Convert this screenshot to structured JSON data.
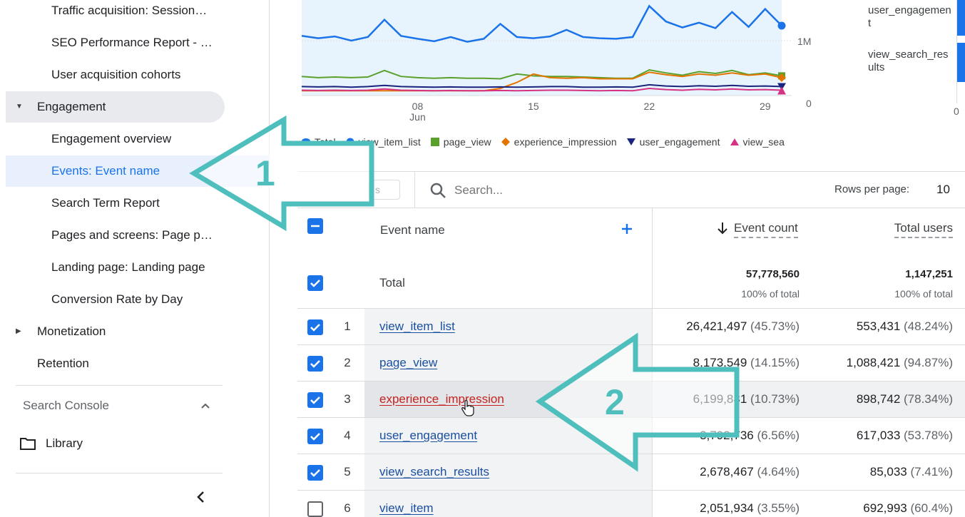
{
  "sidebar": {
    "items_sub_top": [
      "Traffic acquisition: Session…",
      "SEO Performance Report - …",
      "User acquisition cohorts"
    ],
    "engagement": "Engagement",
    "engagement_items": [
      "Engagement overview",
      "Events: Event name",
      "Search Term Report",
      "Pages and screens: Page p…",
      "Landing page: Landing page",
      "Conversion Rate by Day"
    ],
    "monetization": "Monetization",
    "retention": "Retention",
    "search_console": "Search Console",
    "library": "Library"
  },
  "chart": {
    "legend": [
      {
        "label": "Total",
        "color": "#1a73e8",
        "shape": "cloud"
      },
      {
        "label": "view_item_list",
        "color": "#1a73e8",
        "shape": "circle"
      },
      {
        "label": "page_view",
        "color": "#5aa02c",
        "shape": "square"
      },
      {
        "label": "experience_impression",
        "color": "#e37400",
        "shape": "diamond"
      },
      {
        "label": "user_engagement",
        "color": "#1a237e",
        "shape": "triangle-down"
      },
      {
        "label": "view_sea",
        "color": "#d63384",
        "shape": "triangle-up"
      }
    ],
    "x_ticks": [
      {
        "label": "08",
        "sub": "Jun",
        "day": 8
      },
      {
        "label": "15",
        "sub": "",
        "day": 15
      },
      {
        "label": "22",
        "sub": "",
        "day": 22
      },
      {
        "label": "29",
        "sub": "",
        "day": 29
      }
    ],
    "y_ticks": [
      {
        "label": "1M",
        "value": 1000000
      },
      {
        "label": "0",
        "value": 0
      }
    ],
    "right_legend": [
      "user_engagement",
      "view_search_results"
    ],
    "right_axis_zero": "0"
  },
  "chart_data": {
    "type": "line",
    "x": [
      1,
      2,
      3,
      4,
      5,
      6,
      7,
      8,
      9,
      10,
      11,
      12,
      13,
      14,
      15,
      16,
      17,
      18,
      19,
      20,
      21,
      22,
      23,
      24,
      25,
      26,
      27,
      28,
      29,
      30
    ],
    "ylim": [
      0,
      1600000
    ],
    "series": [
      {
        "name": "view_item_list",
        "color": "#1a73e8",
        "values": [
          1000000,
          960000,
          990000,
          920000,
          980000,
          1270000,
          1000000,
          950000,
          910000,
          980000,
          900000,
          950000,
          1200000,
          980000,
          960000,
          990000,
          1100000,
          980000,
          960000,
          950000,
          980000,
          1500000,
          1240000,
          1140000,
          1220000,
          1130000,
          1400000,
          1150000,
          1450000,
          1170000
        ]
      },
      {
        "name": "page_view",
        "color": "#5aa02c",
        "values": [
          320000,
          300000,
          310000,
          300000,
          310000,
          420000,
          320000,
          300000,
          290000,
          300000,
          290000,
          290000,
          280000,
          360000,
          330000,
          320000,
          320000,
          310000,
          300000,
          290000,
          290000,
          430000,
          380000,
          340000,
          400000,
          370000,
          420000,
          350000,
          380000,
          330000
        ]
      },
      {
        "name": "experience_impression",
        "color": "#e37400",
        "values": [
          80000,
          80000,
          80000,
          80000,
          80000,
          80000,
          80000,
          80000,
          80000,
          80000,
          80000,
          80000,
          120000,
          220000,
          360000,
          300000,
          290000,
          300000,
          280000,
          280000,
          280000,
          390000,
          350000,
          320000,
          360000,
          340000,
          380000,
          340000,
          360000,
          300000
        ]
      },
      {
        "name": "user_engagement",
        "color": "#1a237e",
        "values": [
          150000,
          145000,
          150000,
          140000,
          150000,
          170000,
          150000,
          145000,
          140000,
          145000,
          140000,
          140000,
          145000,
          140000,
          145000,
          150000,
          150000,
          140000,
          140000,
          145000,
          140000,
          180000,
          160000,
          150000,
          165000,
          155000,
          170000,
          155000,
          160000,
          150000
        ]
      },
      {
        "name": "view_search_results",
        "color": "#d63384",
        "values": [
          90000,
          85000,
          90000,
          85000,
          90000,
          110000,
          90000,
          85000,
          80000,
          85000,
          80000,
          80000,
          85000,
          80000,
          85000,
          90000,
          90000,
          85000,
          80000,
          85000,
          80000,
          120000,
          100000,
          90000,
          105000,
          95000,
          110000,
          95000,
          100000,
          90000
        ]
      }
    ]
  },
  "toolbar": {
    "search_placeholder": "Search...",
    "rows_label": "Rows per page:",
    "rows_value": "10",
    "ghost": "s"
  },
  "table": {
    "col_event": "Event name",
    "col_count": "Event count",
    "col_users": "Total users",
    "total": {
      "label": "Total",
      "count": "57,778,560",
      "count_pct": "100% of total",
      "users": "1,147,251",
      "users_pct": "100% of total"
    },
    "rows": [
      {
        "idx": "1",
        "name": "view_item_list",
        "count": "26,421,497",
        "count_pct": "(45.73%)",
        "users": "553,431",
        "users_pct": "(48.24%)",
        "checked": true
      },
      {
        "idx": "2",
        "name": "page_view",
        "count": "8,173,549",
        "count_pct": "(14.15%)",
        "users": "1,088,421",
        "users_pct": "(94.87%)",
        "checked": true
      },
      {
        "idx": "3",
        "name": "experience_impression",
        "count": "6,199,881",
        "count_pct": "(10.73%)",
        "users": "898,742",
        "users_pct": "(78.34%)",
        "checked": true
      },
      {
        "idx": "4",
        "name": "user_engagement",
        "count": "3,792,736",
        "count_pct": "(6.56%)",
        "users": "617,033",
        "users_pct": "(53.78%)",
        "checked": true
      },
      {
        "idx": "5",
        "name": "view_search_results",
        "count": "2,678,467",
        "count_pct": "(4.64%)",
        "users": "85,033",
        "users_pct": "(7.41%)",
        "checked": true
      },
      {
        "idx": "6",
        "name": "view_item",
        "count": "2,051,934",
        "count_pct": "(3.55%)",
        "users": "692,993",
        "users_pct": "(60.4%)",
        "checked": false
      }
    ]
  },
  "annotations": {
    "arrow1": "1",
    "arrow2": "2"
  },
  "colors": {
    "accent": "#1a73e8",
    "annotation": "#4fbfbd",
    "link": "#1a4fa0",
    "hover_link": "#c5221f"
  }
}
